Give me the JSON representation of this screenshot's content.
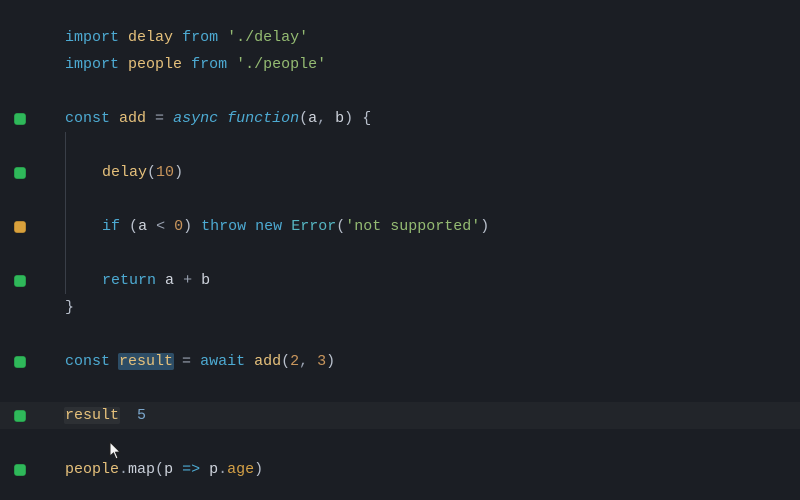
{
  "code": {
    "import_kw": "import",
    "from_kw": "from",
    "const_kw": "const",
    "async_kw": "async",
    "function_kw": "function",
    "if_kw": "if",
    "throw_kw": "throw",
    "new_kw": "new",
    "return_kw": "return",
    "await_kw": "await",
    "arrow": "=>",
    "delay_ident": "delay",
    "people_ident": "people",
    "add_ident": "add",
    "result_ident": "result",
    "a_ident": "a",
    "b_ident": "b",
    "p_ident": "p",
    "error_type": "Error",
    "map_func": "map",
    "age_prop": "age",
    "str_delay": "'./delay'",
    "str_people": "'./people'",
    "str_notsupported": "'not supported'",
    "num_10": "10",
    "num_0": "0",
    "num_2": "2",
    "num_3": "3",
    "inline_result_val": "5"
  },
  "gutter": {
    "markers": [
      "",
      "",
      "",
      "green",
      "",
      "green",
      "",
      "yellow",
      "",
      "green",
      "",
      "",
      "green",
      "",
      "green",
      "",
      "green"
    ]
  }
}
